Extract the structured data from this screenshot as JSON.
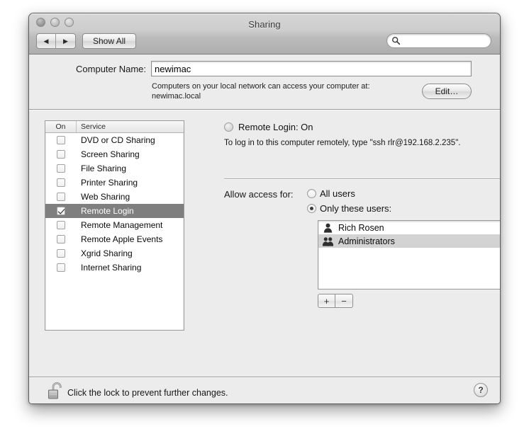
{
  "window": {
    "title": "Sharing",
    "traffic_lights": [
      "close",
      "minimize",
      "zoom"
    ]
  },
  "toolbar": {
    "back_glyph": "◀",
    "forward_glyph": "▶",
    "show_all_label": "Show All",
    "search_placeholder": "",
    "search_value": ""
  },
  "computer_name": {
    "label": "Computer Name:",
    "value": "newimac",
    "hint_line1": "Computers on your local network can access your computer at:",
    "hint_line2": "newimac.local",
    "edit_label": "Edit…"
  },
  "service_list": {
    "header_on": "On",
    "header_service": "Service",
    "rows": [
      {
        "name": "DVD or CD Sharing",
        "checked": false,
        "selected": false
      },
      {
        "name": "Screen Sharing",
        "checked": false,
        "selected": false
      },
      {
        "name": "File Sharing",
        "checked": false,
        "selected": false
      },
      {
        "name": "Printer Sharing",
        "checked": false,
        "selected": false
      },
      {
        "name": "Web Sharing",
        "checked": false,
        "selected": false
      },
      {
        "name": "Remote Login",
        "checked": true,
        "selected": true
      },
      {
        "name": "Remote Management",
        "checked": false,
        "selected": false
      },
      {
        "name": "Remote Apple Events",
        "checked": false,
        "selected": false
      },
      {
        "name": "Xgrid Sharing",
        "checked": false,
        "selected": false
      },
      {
        "name": "Internet Sharing",
        "checked": false,
        "selected": false
      }
    ]
  },
  "detail": {
    "status_title": "Remote Login: On",
    "status_description": "To log in to this computer remotely, type \"ssh rlr@192.168.2.235\".",
    "allow_label": "Allow access for:",
    "radio_all_users": "All users",
    "radio_only_these": "Only these users:",
    "radio_selected": "only_these",
    "users": [
      {
        "name": "Rich Rosen",
        "kind": "user",
        "selected": false
      },
      {
        "name": "Administrators",
        "kind": "group",
        "selected": true
      }
    ],
    "add_label": "+",
    "remove_label": "−"
  },
  "footer": {
    "lock_state": "unlocked",
    "lock_text": "Click the lock to prevent further changes.",
    "help_label": "?"
  },
  "colors": {
    "window_bg": "#ececec",
    "titlebar_top": "#d6d6d6",
    "titlebar_bottom": "#aeaeae",
    "selection_inactive": "#7f7f7f",
    "row_highlight": "#d3d3d3",
    "text": "#111111"
  }
}
